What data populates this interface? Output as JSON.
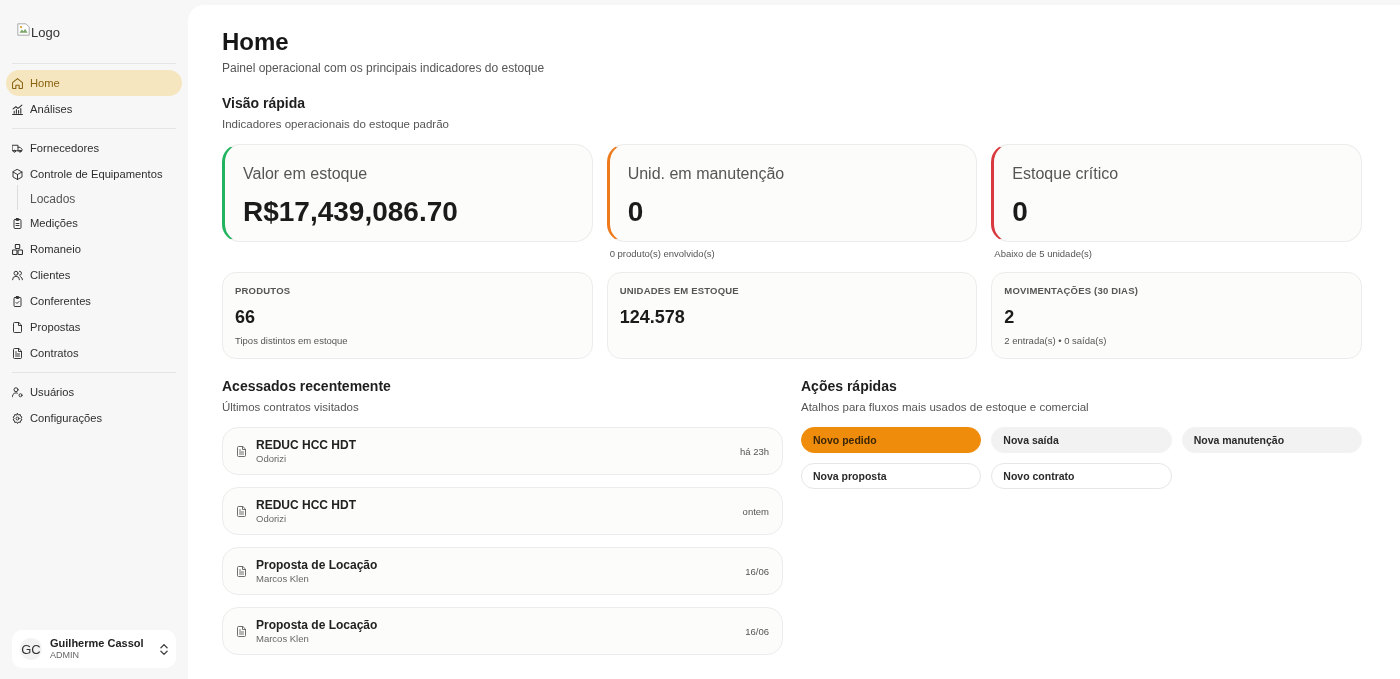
{
  "sidebar": {
    "logo": "Logo",
    "groups": [
      {
        "items": [
          {
            "label": "Home",
            "selected": true
          },
          {
            "label": "Análises",
            "selected": false
          }
        ]
      },
      {
        "items": [
          {
            "label": "Fornecedores",
            "selected": false
          },
          {
            "label": "Controle de Equipamentos",
            "selected": false,
            "children": [
              {
                "label": "Locados",
                "selected": false
              }
            ]
          },
          {
            "label": "Medições",
            "selected": false
          },
          {
            "label": "Romaneio",
            "selected": false
          },
          {
            "label": "Clientes",
            "selected": false
          },
          {
            "label": "Conferentes",
            "selected": false
          },
          {
            "label": "Propostas",
            "selected": false
          },
          {
            "label": "Contratos",
            "selected": false
          }
        ]
      },
      {
        "items": [
          {
            "label": "Usuários",
            "selected": false
          },
          {
            "label": "Configurações",
            "selected": false
          }
        ]
      }
    ],
    "user": {
      "initials": "GC",
      "name": "Guilherme Cassol",
      "role": "ADMIN"
    }
  },
  "header": {
    "title": "Home",
    "subtitle": "Painel operacional com os principais indicadores do estoque"
  },
  "overview": {
    "title": "Visão rápida",
    "subtitle": "Indicadores operacionais do estoque padrão",
    "kpis": [
      {
        "label": "Valor em estoque",
        "value": "R$17,439,086.70",
        "color": "#22b35e"
      },
      {
        "label": "Unid. em manutenção",
        "value": "0",
        "note": "0 produto(s) envolvido(s)",
        "color": "#ee7a1c"
      },
      {
        "label": "Estoque crítico",
        "value": "0",
        "note": "Abaixo de 5 unidade(s)",
        "color": "#d83a40"
      }
    ],
    "stats": [
      {
        "label": "PRODUTOS",
        "value": "66",
        "note": "Tipos distintos em estoque"
      },
      {
        "label": "UNIDADES EM ESTOQUE",
        "value": "124.578"
      },
      {
        "label": "MOVIMENTAÇÕES (30 DIAS)",
        "value": "2",
        "note": "2 entrada(s) • 0 saída(s)"
      }
    ]
  },
  "recent": {
    "title": "Acessados recentemente",
    "subtitle": "Últimos contratos visitados",
    "items": [
      {
        "title": "REDUC HCC HDT",
        "subtitle": "Odorizi",
        "time": "há 23h"
      },
      {
        "title": "REDUC HCC HDT",
        "subtitle": "Odorizi",
        "time": "ontem"
      },
      {
        "title": "Proposta de Locação",
        "subtitle": "Marcos Klen",
        "time": "16/06"
      },
      {
        "title": "Proposta de Locação",
        "subtitle": "Marcos Klen",
        "time": "16/06"
      }
    ]
  },
  "quick_actions": {
    "title": "Ações rápidas",
    "subtitle": "Atalhos para fluxos mais usados de estoque e comercial",
    "actions": [
      {
        "label": "Novo pedido",
        "kind": "primary"
      },
      {
        "label": "Nova saída",
        "kind": "secondary"
      },
      {
        "label": "Nova manutenção",
        "kind": "secondary"
      },
      {
        "label": "Nova proposta",
        "kind": "outline"
      },
      {
        "label": "Novo contrato",
        "kind": "outline"
      }
    ]
  }
}
